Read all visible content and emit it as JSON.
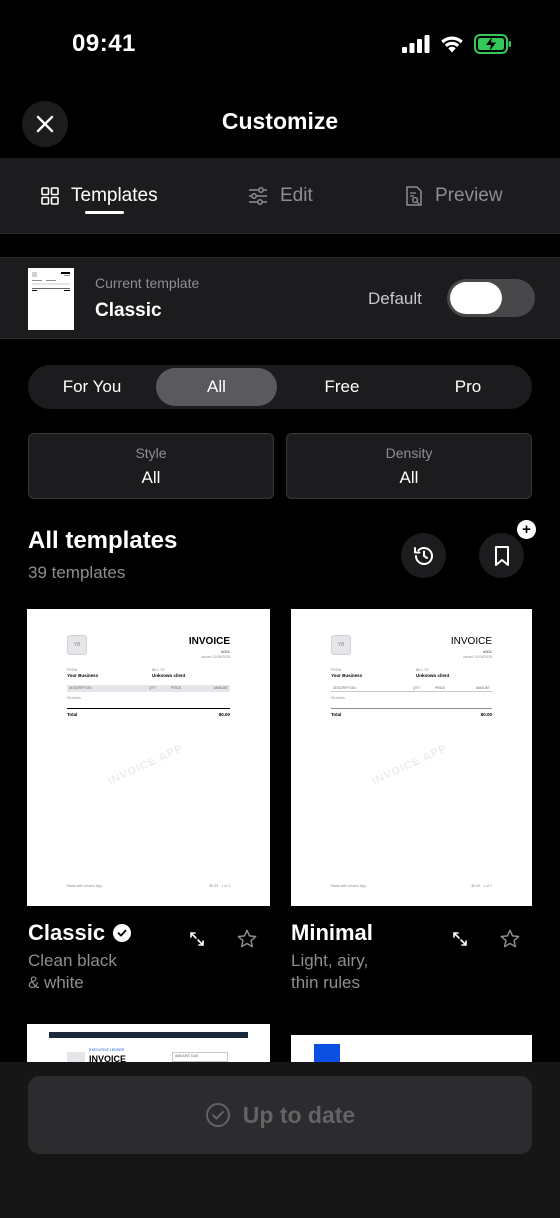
{
  "status_bar": {
    "time": "09:41"
  },
  "nav": {
    "title": "Customize"
  },
  "tabs": [
    {
      "label": "Templates",
      "icon": "grid-icon",
      "active": true
    },
    {
      "label": "Edit",
      "icon": "sliders-icon",
      "active": false
    },
    {
      "label": "Preview",
      "icon": "document-preview-icon",
      "active": false
    }
  ],
  "current_template": {
    "label": "Current template",
    "name": "Classic",
    "default_label": "Default",
    "default_on": false
  },
  "segments": [
    "For You",
    "All",
    "Free",
    "Pro"
  ],
  "selected_segment": "All",
  "filters": [
    {
      "label": "Style",
      "value": "All"
    },
    {
      "label": "Density",
      "value": "All"
    }
  ],
  "section": {
    "title": "All templates",
    "count": "39 templates"
  },
  "invoice_preview": {
    "logo": "YB",
    "title": "INVOICE",
    "number": "#001",
    "issued": "Issued 12/05/2025",
    "from_label": "FROM",
    "from": "Your Business",
    "to_label": "BILL TO",
    "to": "Unknown client",
    "col_description": "DESCRIPTION",
    "col_qty": "QTY",
    "col_price": "PRICE",
    "col_amount": "AMOUNT",
    "no_items": "No items",
    "total_label": "Total",
    "total": "$0.00",
    "watermark": "INVOICE APP",
    "footer_left": "Made with Invoice App",
    "footer_right": "$0.00 · 1 of 1"
  },
  "templates": [
    {
      "name": "Classic",
      "desc_line1": "Clean black",
      "desc_line2": "& white",
      "selected": true
    },
    {
      "name": "Minimal",
      "desc_line1": "Light, airy,",
      "desc_line2": "thin rules",
      "selected": false
    }
  ],
  "partial_previews": {
    "third_header": "EXECUTIVE LEDGER",
    "third_title": "INVOICE",
    "third_amount_label": "AMOUNT DUE"
  },
  "bottom": {
    "cta": "Up to date"
  },
  "colors": {
    "background": "#000000",
    "surface": "#1c1c1e",
    "muted": "#8e8e93",
    "accent_blue": "#0a4fe0"
  }
}
